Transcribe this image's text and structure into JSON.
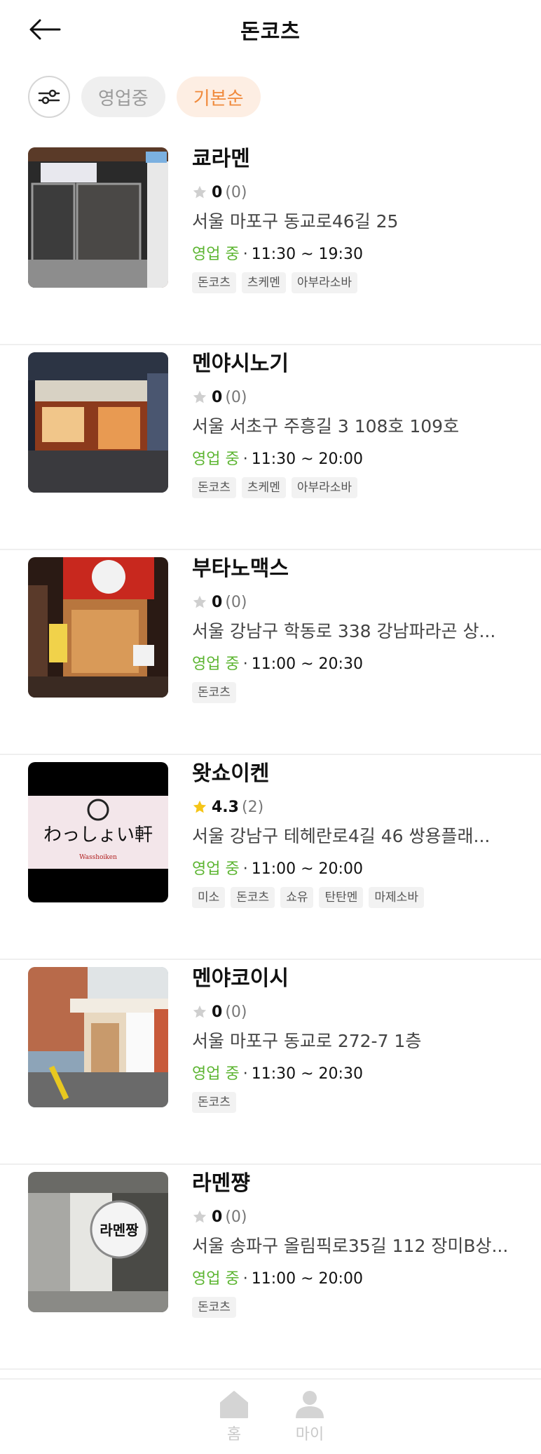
{
  "header": {
    "title": "돈코츠",
    "back_icon": "arrow-left-icon"
  },
  "filters": {
    "filter_icon": "sliders-icon",
    "chips": [
      {
        "label": "영업중",
        "active": false
      },
      {
        "label": "기본순",
        "active": true
      }
    ]
  },
  "colors": {
    "accent": "#f08a3c",
    "open_status": "#5cb531",
    "star_filled": "#f5c518",
    "star_empty": "#cfcfcf"
  },
  "restaurants": [
    {
      "name": "쿄라멘",
      "score": "0",
      "reviews": "(0)",
      "rated": false,
      "address": "서울 마포구 동교로46길 25",
      "status": "영업 중",
      "hours": "11:30 ~ 19:30",
      "tags": [
        "돈코츠",
        "츠케멘",
        "아부라소바"
      ]
    },
    {
      "name": "멘야시노기",
      "score": "0",
      "reviews": "(0)",
      "rated": false,
      "address": "서울 서초구 주흥길 3 108호 109호",
      "status": "영업 중",
      "hours": "11:30 ~ 20:00",
      "tags": [
        "돈코츠",
        "츠케멘",
        "아부라소바"
      ]
    },
    {
      "name": "부타노맥스",
      "score": "0",
      "reviews": "(0)",
      "rated": false,
      "address": "서울 강남구 학동로 338 강남파라곤 상...",
      "status": "영업 중",
      "hours": "11:00 ~ 20:30",
      "tags": [
        "돈코츠"
      ]
    },
    {
      "name": "왓쇼이켄",
      "score": "4.3",
      "reviews": "(2)",
      "rated": true,
      "address": "서울 강남구 테헤란로4길 46 쌍용플래...",
      "status": "영업 중",
      "hours": "11:00 ~ 20:00",
      "tags": [
        "미소",
        "돈코츠",
        "쇼유",
        "탄탄멘",
        "마제소바"
      ],
      "logo_text": "わっしょい軒",
      "logo_sub": "Wasshoiken"
    },
    {
      "name": "멘야코이시",
      "score": "0",
      "reviews": "(0)",
      "rated": false,
      "address": "서울 마포구 동교로 272-7 1층",
      "status": "영업 중",
      "hours": "11:30 ~ 20:30",
      "tags": [
        "돈코츠"
      ]
    },
    {
      "name": "라멘쨩",
      "score": "0",
      "reviews": "(0)",
      "rated": false,
      "address": "서울 송파구 올림픽로35길 112 장미B상...",
      "status": "영업 중",
      "hours": "11:00 ~ 20:00",
      "tags": [
        "돈코츠"
      ],
      "sign_text": "라멘짱"
    }
  ],
  "bottom_nav": [
    {
      "label": "홈",
      "icon": "home-icon"
    },
    {
      "label": "마이",
      "icon": "person-icon"
    }
  ]
}
